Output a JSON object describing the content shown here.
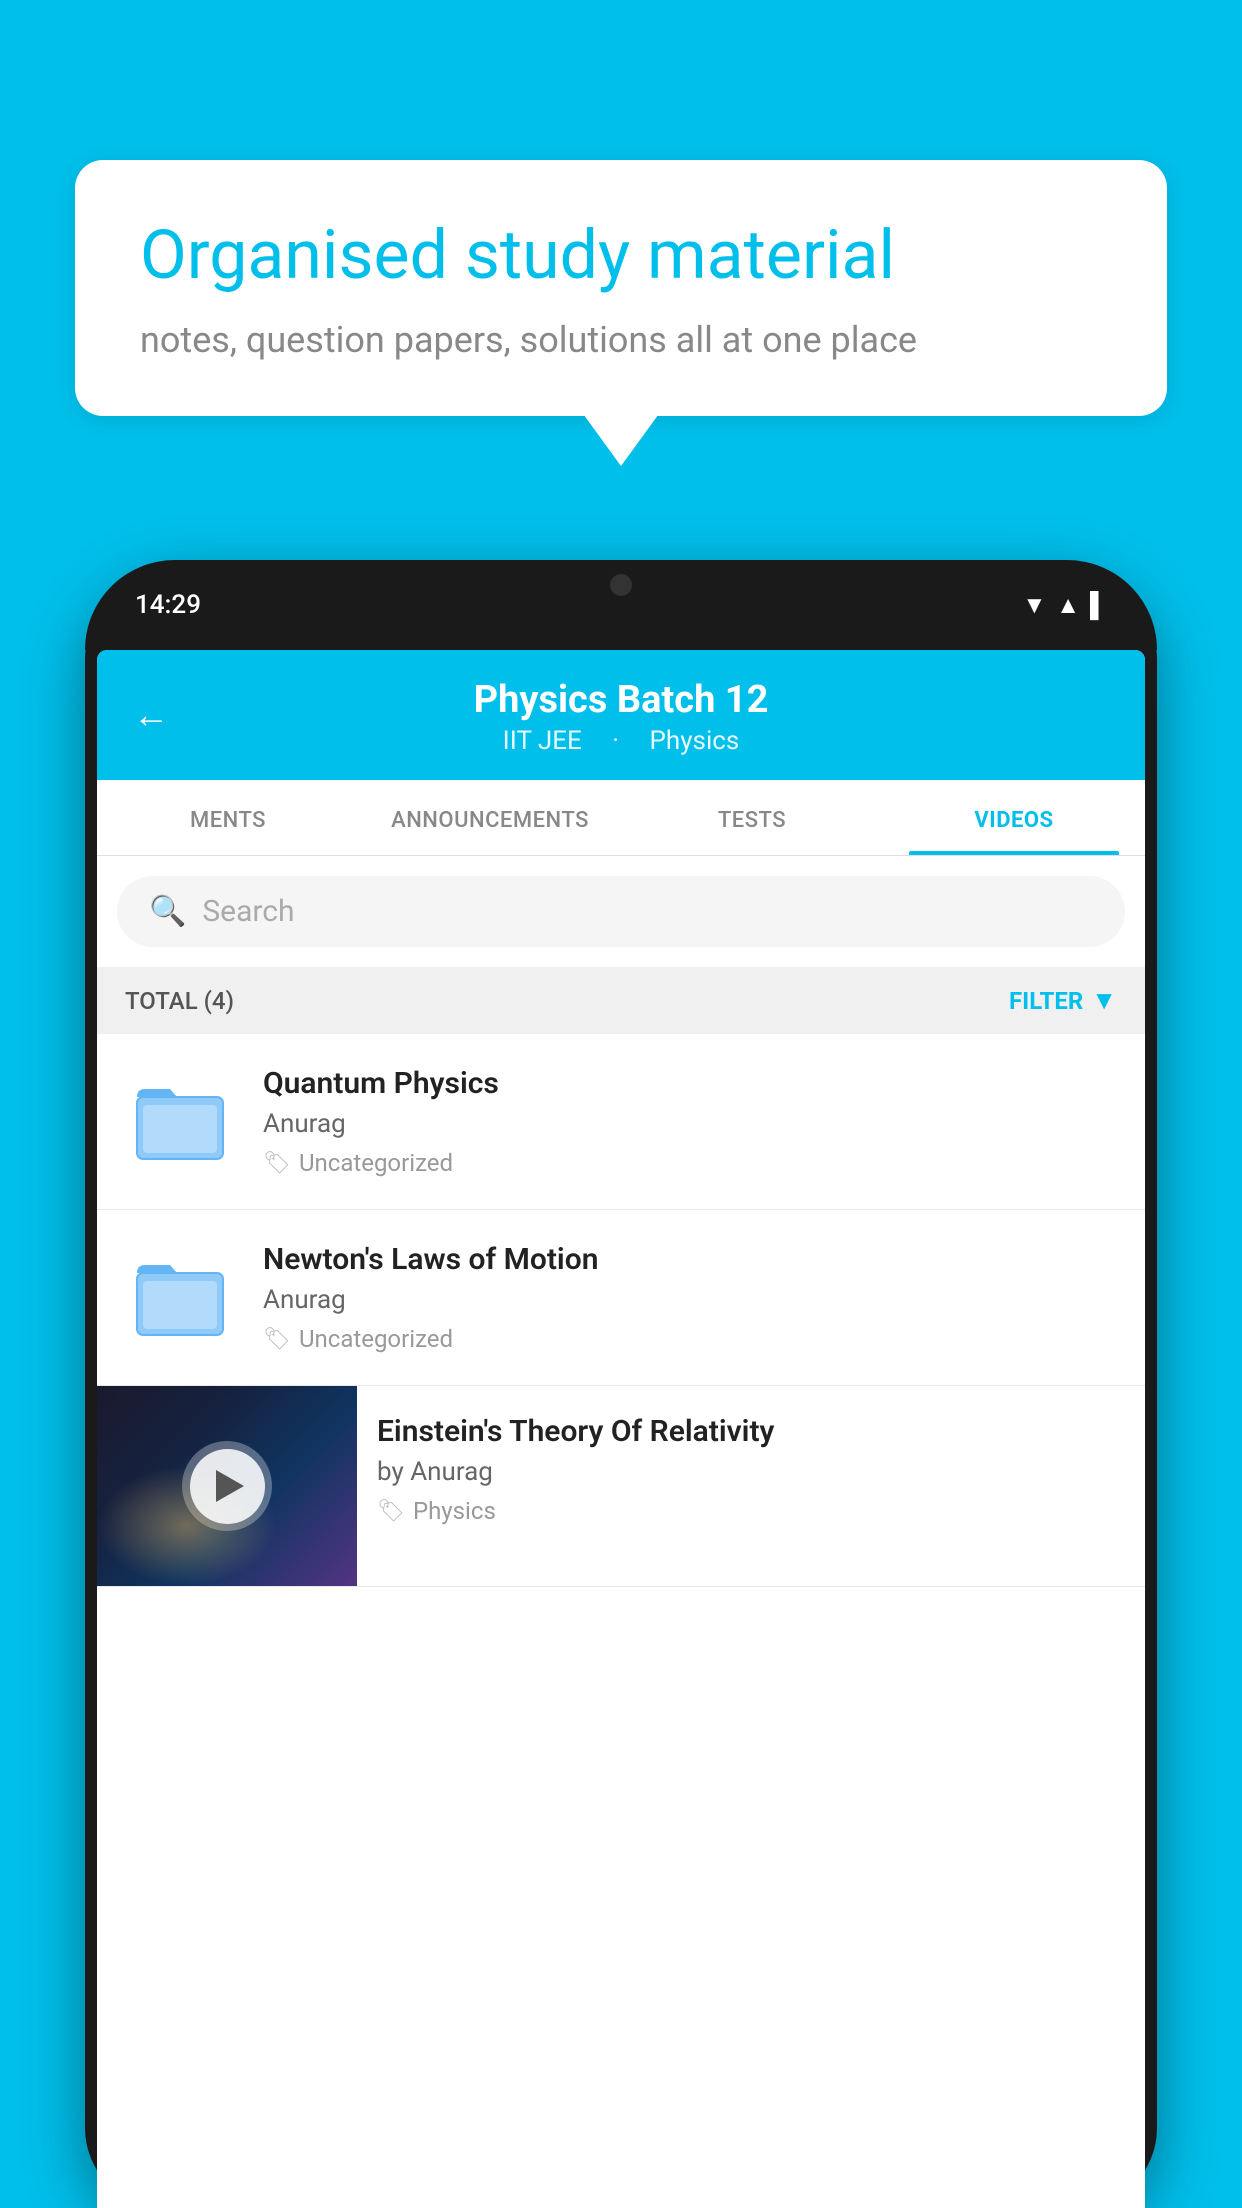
{
  "background_color": "#00BFEA",
  "speech_bubble": {
    "title": "Organised study material",
    "subtitle": "notes, question papers, solutions all at one place"
  },
  "phone": {
    "status_bar": {
      "time": "14:29"
    },
    "header": {
      "back_label": "←",
      "title": "Physics Batch 12",
      "subtitle_left": "IIT JEE",
      "subtitle_right": "Physics"
    },
    "tabs": [
      {
        "label": "MENTS",
        "active": false
      },
      {
        "label": "ANNOUNCEMENTS",
        "active": false
      },
      {
        "label": "TESTS",
        "active": false
      },
      {
        "label": "VIDEOS",
        "active": true
      }
    ],
    "search": {
      "placeholder": "Search"
    },
    "filter_row": {
      "total_label": "TOTAL (4)",
      "filter_label": "FILTER"
    },
    "video_items": [
      {
        "id": 1,
        "title": "Quantum Physics",
        "author": "Anurag",
        "tag": "Uncategorized",
        "has_thumbnail": false
      },
      {
        "id": 2,
        "title": "Newton's Laws of Motion",
        "author": "Anurag",
        "tag": "Uncategorized",
        "has_thumbnail": false
      },
      {
        "id": 3,
        "title": "Einstein's Theory Of Relativity",
        "author": "by Anurag",
        "tag": "Physics",
        "has_thumbnail": true
      }
    ]
  }
}
